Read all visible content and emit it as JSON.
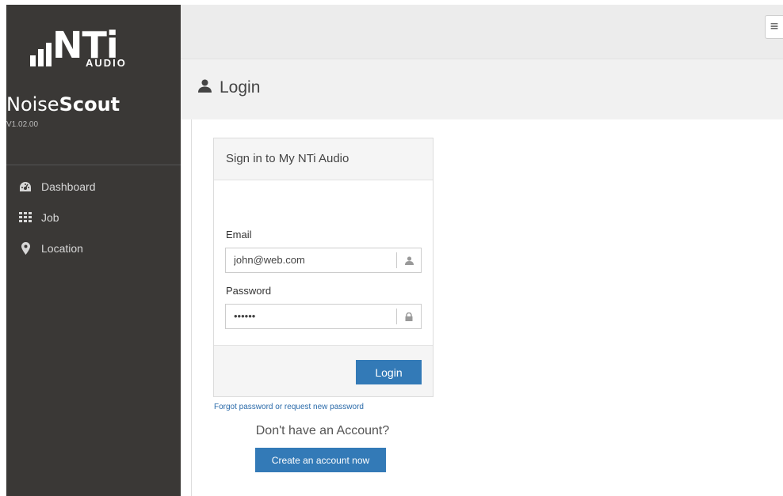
{
  "brand": {
    "logo_text": "NTi",
    "logo_sub": "AUDIO",
    "app_name_light": "Noise",
    "app_name_bold": "Scout",
    "version": "V1.02.00"
  },
  "sidebar": {
    "items": [
      {
        "label": "Dashboard",
        "icon": "dashboard-icon"
      },
      {
        "label": "Job",
        "icon": "grid-icon"
      },
      {
        "label": "Location",
        "icon": "map-marker-icon"
      }
    ]
  },
  "topbar": {
    "menu_icon": "hamburger-icon"
  },
  "page": {
    "title": "Login",
    "title_icon": "user-icon"
  },
  "login_card": {
    "header": "Sign in to My NTi Audio",
    "email_label": "Email",
    "email_value": "john@web.com",
    "password_label": "Password",
    "password_value": "••••••",
    "login_button": "Login"
  },
  "links": {
    "forgot": "Forgot password or request new password",
    "no_account": "Don't have an Account?",
    "create_account": "Create an account now"
  },
  "colors": {
    "sidebar_bg": "#3a3836",
    "primary": "#337ab7",
    "link": "#2a6aa9"
  }
}
